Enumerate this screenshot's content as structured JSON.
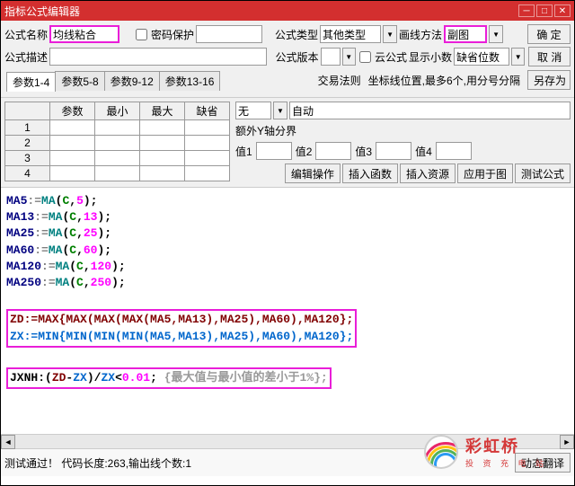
{
  "title": "指标公式编辑器",
  "row1": {
    "name_lbl": "公式名称",
    "name_val": "均线粘合",
    "protect_lbl": "密码保护",
    "type_lbl": "公式类型",
    "type_val": "其他类型",
    "draw_lbl": "画线方法",
    "draw_val": "副图",
    "ok": "确  定"
  },
  "row2": {
    "desc_lbl": "公式描述",
    "ver_lbl": "公式版本",
    "cloud_lbl": "云公式",
    "disp_lbl": "显示小数",
    "disp_val": "缺省位数",
    "cancel": "取  消"
  },
  "row3": {
    "rule_lbl": "交易法则",
    "coord_lbl": "坐标线位置,最多6个,用分号分隔",
    "saveas": "另存为"
  },
  "row4": {
    "none": "无",
    "auto": "自动"
  },
  "tabs": [
    "参数1-4",
    "参数5-8",
    "参数9-12",
    "参数13-16"
  ],
  "params": {
    "headers": [
      "参数",
      "最小",
      "最大",
      "缺省"
    ],
    "rows": [
      "1",
      "2",
      "3",
      "4"
    ]
  },
  "extra_y": "额外Y轴分界",
  "vals": [
    "值1",
    "值2",
    "值3",
    "值4"
  ],
  "btns": [
    "编辑操作",
    "插入函数",
    "插入资源",
    "应用于图",
    "测试公式"
  ],
  "code": {
    "l1": {
      "v": "MA5",
      "fn": "MA",
      "a1": "C",
      "a2": "5"
    },
    "l2": {
      "v": "MA13",
      "fn": "MA",
      "a1": "C",
      "a2": "13"
    },
    "l3": {
      "v": "MA25",
      "fn": "MA",
      "a1": "C",
      "a2": "25"
    },
    "l4": {
      "v": "MA60",
      "fn": "MA",
      "a1": "C",
      "a2": "60"
    },
    "l5": {
      "v": "MA120",
      "fn": "MA",
      "a1": "C",
      "a2": "120"
    },
    "l6": {
      "v": "MA250",
      "fn": "MA",
      "a1": "C",
      "a2": "250"
    },
    "zd": "ZD:=MAX{MAX(MAX(MAX(MA5,MA13),MA25),MA60),MA120};",
    "zx": "ZX:=MIN{MIN(MIN(MIN(MA5,MA13),MA25),MA60),MA120};",
    "jxnh_l": "JXNH:(",
    "jxnh_zd": "ZD",
    "jxnh_m1": "-",
    "jxnh_zx": "ZX",
    "jxnh_m2": ")/",
    "jxnh_zx2": "ZX",
    "jxnh_m3": "<",
    "jxnh_n": "0.01",
    "jxnh_e": "; ",
    "jxnh_c": "{最大值与最小值的差小于1%};"
  },
  "status": "测试通过！ 代码长度:263,输出线个数:1",
  "translate_btn": "动态翻译",
  "watermark": {
    "main": "彩虹桥",
    "sub": "投 资 充 电 站"
  }
}
